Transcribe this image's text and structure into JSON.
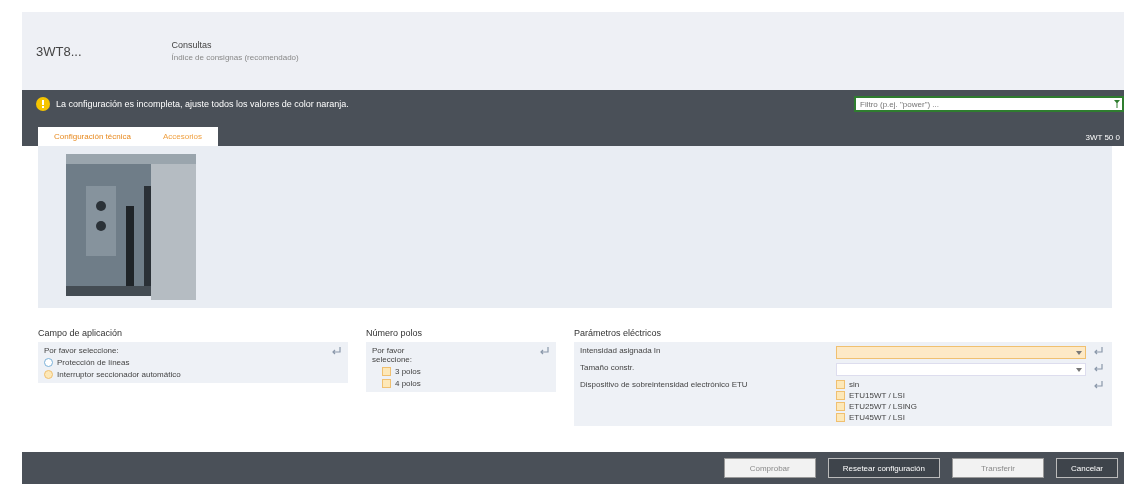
{
  "header": {
    "product": "3WT8...",
    "title": "Consultas",
    "subtitle": "Índice de consignas (recomendado)"
  },
  "alert": {
    "message": "La configuración es incompleta, ajuste todos los valores de color naranja."
  },
  "search": {
    "placeholder": "Filtro (p.ej. \"power\") ..."
  },
  "tabs": [
    {
      "label": "Configuración técnica",
      "selected": true
    },
    {
      "label": "Accesorios",
      "selected": false
    }
  ],
  "order_number": "3WT 50 0",
  "groups": [
    {
      "title": "Campo de aplicación",
      "prompt": "Por favor seleccione:",
      "options": [
        {
          "kind": "radio",
          "label": "Protección de líneas",
          "selected": false,
          "required": false
        },
        {
          "kind": "radio",
          "label": "Interruptor seccionador automático",
          "selected": false,
          "required": true
        }
      ]
    },
    {
      "title": "Número polos",
      "prompt": "Por favor seleccione:",
      "options": [
        {
          "kind": "checkbox",
          "label": "3 polos",
          "selected": false,
          "required": true
        },
        {
          "kind": "checkbox",
          "label": "4 polos",
          "selected": false,
          "required": true
        }
      ]
    }
  ],
  "electrical": {
    "title": "Parámetros eléctricos",
    "params": [
      {
        "kind": "dropdown",
        "label": "Intensidad asignada In",
        "required": true
      },
      {
        "kind": "dropdown",
        "label": "Tamaño constr.",
        "required": false
      },
      {
        "kind": "list",
        "label": "Dispositivo de sobreintensidad electrónico ETU",
        "options": [
          {
            "label": "sin",
            "required": true
          },
          {
            "label": "ETU15WT / LSI",
            "required": true
          },
          {
            "label": "ETU25WT / LSING",
            "required": true
          },
          {
            "label": "ETU45WT / LSI",
            "required": true
          }
        ]
      }
    ]
  },
  "buttons": [
    {
      "label": "Comprobar",
      "kind": "light",
      "disabled": true
    },
    {
      "label": "Resetear configuración",
      "kind": "dark",
      "disabled": false
    },
    {
      "label": "Transferir",
      "kind": "light",
      "disabled": true
    },
    {
      "label": "Cancelar",
      "kind": "dark",
      "disabled": false
    }
  ]
}
